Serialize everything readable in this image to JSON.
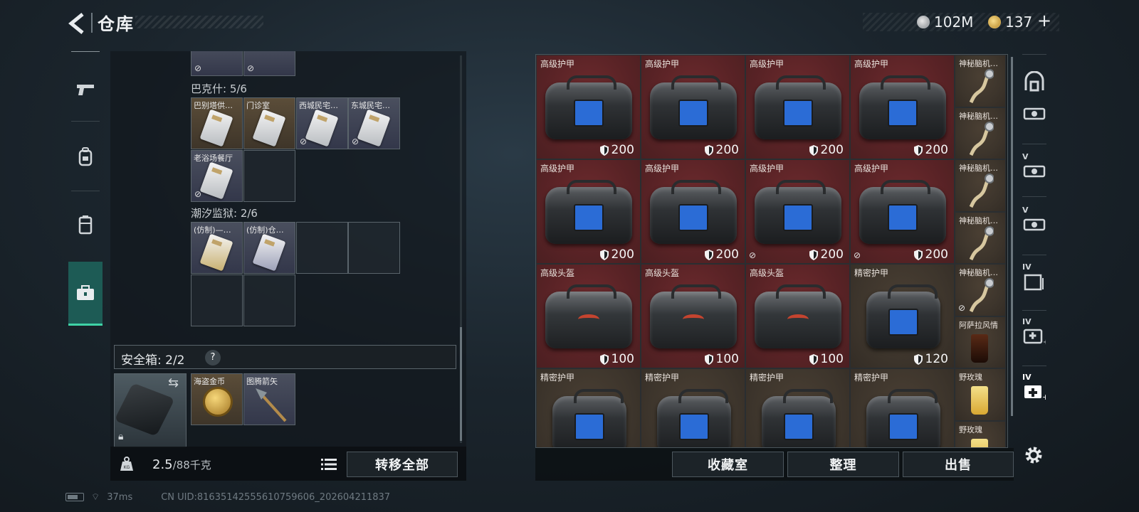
{
  "header": {
    "title": "仓库",
    "currencies": [
      {
        "icon": "silver-coin-icon",
        "value": "102M"
      },
      {
        "icon": "gold-coin-icon",
        "value": "137"
      }
    ],
    "add_label": "+"
  },
  "side_nav": [
    {
      "icon": "pistol-icon",
      "active": false
    },
    {
      "icon": "backpack-icon",
      "active": false
    },
    {
      "icon": "vest-icon",
      "active": false
    },
    {
      "icon": "toolbox-icon",
      "active": true
    }
  ],
  "storage": {
    "sections": [
      {
        "label": "巴克什: 5/6",
        "slots": [
          "巴别塔供…",
          "门诊室",
          "西城民宅…",
          "东城民宅…",
          "老浴场餐厅"
        ]
      },
      {
        "label": "潮汐监狱: 2/6",
        "slots": [
          "(仿制)—…",
          "(仿制)仓…"
        ]
      }
    ],
    "safebox_label": "安全箱: 2/2",
    "safebox_help": "?",
    "safebox_items": [
      "海盗金币",
      "图腾箭矢"
    ],
    "weight_value": "2.5",
    "weight_unit": "/88千克",
    "transfer_all_label": "转移全部"
  },
  "grid": {
    "rows": [
      [
        {
          "name": "高级护甲",
          "durability": "200",
          "no_trade": false
        },
        {
          "name": "高级护甲",
          "durability": "200",
          "no_trade": false
        },
        {
          "name": "高级护甲",
          "durability": "200",
          "no_trade": false
        },
        {
          "name": "高级护甲",
          "durability": "200",
          "no_trade": false
        }
      ],
      [
        {
          "name": "高级护甲",
          "durability": "200",
          "no_trade": false
        },
        {
          "name": "高级护甲",
          "durability": "200",
          "no_trade": false
        },
        {
          "name": "高级护甲",
          "durability": "200",
          "no_trade": true
        },
        {
          "name": "高级护甲",
          "durability": "200",
          "no_trade": true
        }
      ],
      [
        {
          "name": "高级头盔",
          "durability": "100",
          "no_trade": false
        },
        {
          "name": "高级头盔",
          "durability": "100",
          "no_trade": false
        },
        {
          "name": "高级头盔",
          "durability": "100",
          "no_trade": false
        },
        {
          "name": "精密护甲",
          "durability": "120",
          "no_trade": false
        }
      ],
      [
        {
          "name": "精密护甲"
        },
        {
          "name": "精密护甲"
        },
        {
          "name": "精密护甲"
        },
        {
          "name": "精密护甲"
        }
      ]
    ],
    "side_items": [
      "神秘脑机…",
      "神秘脑机…",
      "神秘脑机…",
      "神秘脑机…",
      "神秘脑机…",
      "阿萨拉风情",
      "野玫瑰",
      "野玫瑰"
    ],
    "collection_label": "收藏室",
    "sort_label": "整理",
    "sell_label": "出售"
  },
  "tools": [
    "safe-room-icon",
    "case-icon",
    "V",
    "V",
    "IV",
    "IV",
    "IV"
  ],
  "status": {
    "ping": "37ms",
    "uid": "CN UID:8163514255561075960​6_202604211837"
  },
  "colors": {
    "accent": "#3fd3a6",
    "rare_red": "#5a2326",
    "common_brown": "#3d352c"
  }
}
